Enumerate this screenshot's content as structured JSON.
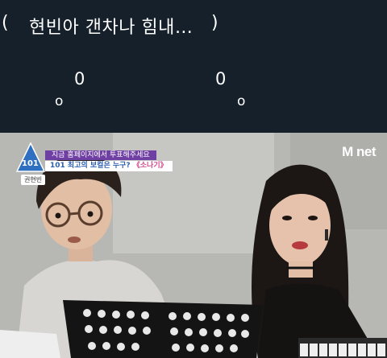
{
  "caption": {
    "open_paren": "(",
    "text": "현빈아 갠차나 힘내…",
    "close_paren": ")"
  },
  "eye_glyphs": {
    "left_big": "0",
    "left_small": "o",
    "right_big": "0",
    "right_small": "o"
  },
  "video": {
    "logo_text": "101",
    "banner_top": "지금 홈페이지에서 투표해주세요",
    "banner_bottom_main": "101 최고의 보컬은 누구? ",
    "banner_bottom_accent": "《소나기》",
    "tag": "권현빈",
    "broadcaster_logo": "M net"
  },
  "colors": {
    "background": "#15202b",
    "banner_purple": "#6f3fa3",
    "banner_text_blue": "#2d5fb0",
    "accent_pink": "#d44a8e"
  }
}
